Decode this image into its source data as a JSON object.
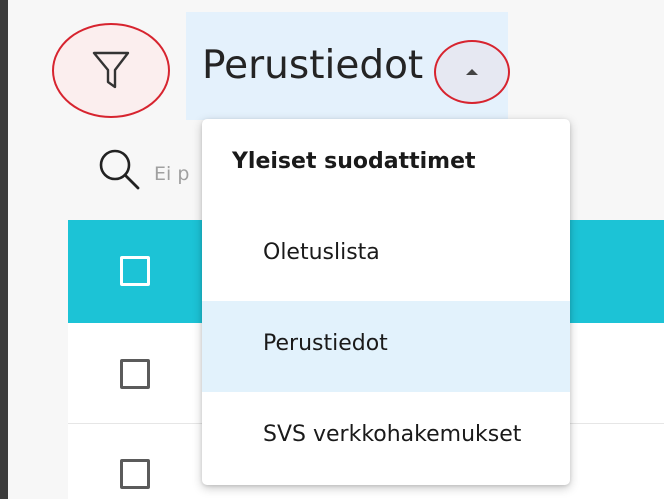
{
  "filter": {
    "icon": "filter-icon"
  },
  "selector": {
    "label": "Perustiedot",
    "caret_icon": "caret-up-icon"
  },
  "search": {
    "icon": "search-icon",
    "placeholder": "Ei p"
  },
  "menu": {
    "header": "Yleiset suodattimet",
    "items": [
      {
        "label": "Oletuslista",
        "selected": false
      },
      {
        "label": "Perustiedot",
        "selected": true
      },
      {
        "label": "SVS verkkohakemukset",
        "selected": false
      }
    ]
  },
  "colors": {
    "accent": "#1cc3d6",
    "highlight_ring": "#d7242f",
    "selector_bg": "#e4f1fc",
    "selected_item_bg": "#e2f2fc",
    "sidebar": "#3c3c3c"
  }
}
